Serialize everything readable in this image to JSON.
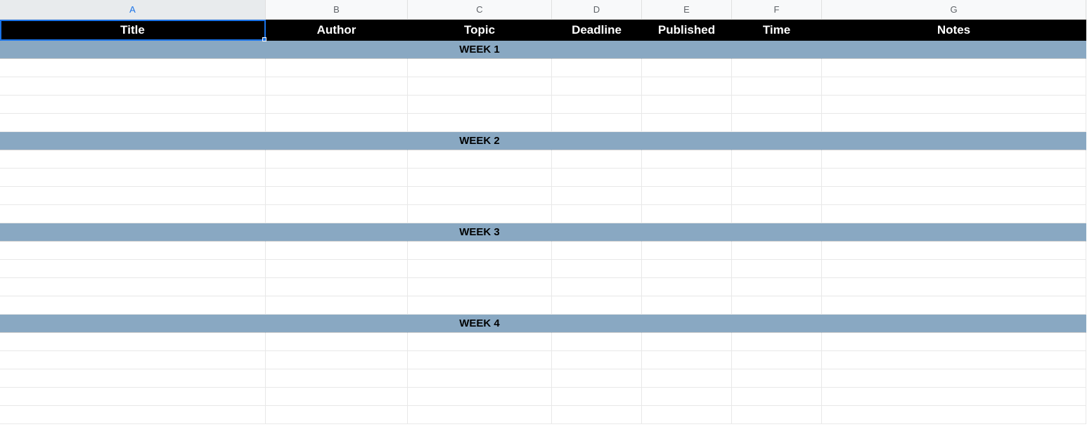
{
  "columns": [
    {
      "id": "A",
      "label": "A",
      "selected": true
    },
    {
      "id": "B",
      "label": "B",
      "selected": false
    },
    {
      "id": "C",
      "label": "C",
      "selected": false
    },
    {
      "id": "D",
      "label": "D",
      "selected": false
    },
    {
      "id": "E",
      "label": "E",
      "selected": false
    },
    {
      "id": "F",
      "label": "F",
      "selected": false
    },
    {
      "id": "G",
      "label": "G",
      "selected": false
    }
  ],
  "headers": {
    "title": "Title",
    "author": "Author",
    "topic": "Topic",
    "deadline": "Deadline",
    "published": "Published",
    "time": "Time",
    "notes": "Notes"
  },
  "weeks": {
    "week1": "WEEK 1",
    "week2": "WEEK 2",
    "week3": "WEEK 3",
    "week4": "WEEK 4"
  }
}
